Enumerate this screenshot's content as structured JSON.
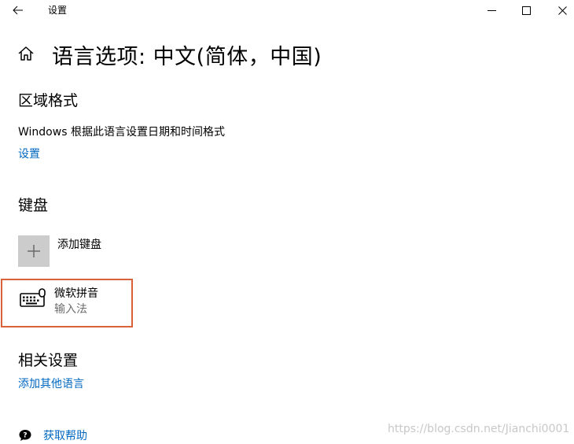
{
  "titlebar": {
    "app_title": "设置",
    "back_icon": "arrow-left-icon",
    "minimize_icon": "minimize-icon",
    "maximize_icon": "maximize-icon",
    "close_icon": "close-icon"
  },
  "header": {
    "home_icon": "home-icon",
    "title": "语言选项: 中文(简体，中国)"
  },
  "region": {
    "heading": "区域格式",
    "description": "Windows 根据此语言设置日期和时间格式",
    "settings_link": "设置"
  },
  "keyboard": {
    "heading": "键盘",
    "add_label": "添加键盘",
    "add_icon": "plus-icon",
    "items": [
      {
        "name": "微软拼音",
        "type": "输入法",
        "icon": "keyboard-icon",
        "selected": true
      }
    ],
    "selection_color": "#d9623a"
  },
  "related": {
    "heading": "相关设置",
    "add_language_link": "添加其他语言"
  },
  "help": {
    "label": "获取帮助",
    "icon": "help-chat-icon"
  },
  "watermark": "https://blog.csdn.net/Jianchi0001",
  "colors": {
    "link": "#0067c0",
    "secondary_text": "#6d6d6d",
    "tile_bg": "#cccccc"
  }
}
